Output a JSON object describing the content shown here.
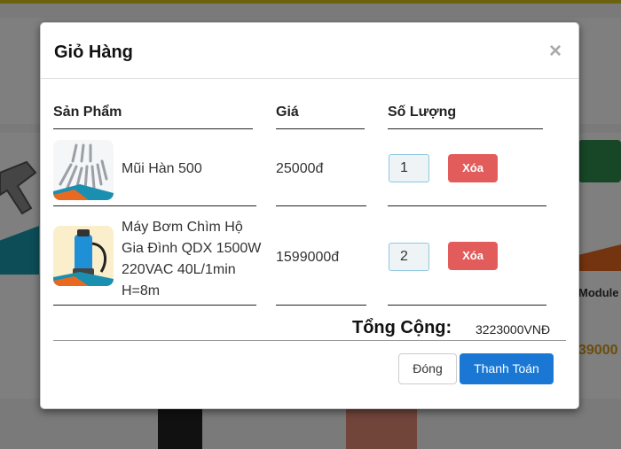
{
  "background": {
    "module_label": "Module",
    "price_fragment": "39000"
  },
  "cart": {
    "title": "Giỏ Hàng",
    "close_icon": "×",
    "columns": {
      "product": "Sản Phẩm",
      "price": "Giá",
      "quantity": "Số Lượng"
    },
    "items": [
      {
        "name": "Mũi Hàn 500",
        "price": "25000đ",
        "quantity": "1",
        "delete_label": "Xóa",
        "image": "soldering-tips-image"
      },
      {
        "name": "Máy Bơm Chìm Hộ Gia Đình QDX 1500W 220VAC 40L/1min H=8m",
        "price": "1599000đ",
        "quantity": "2",
        "delete_label": "Xóa",
        "image": "submersible-pump-image"
      }
    ],
    "total_label": "Tổng Cộng:",
    "total_value": "3223000VNĐ",
    "close_button": "Đóng",
    "checkout_button": "Thanh Toán"
  },
  "colors": {
    "delete_button": "#e35c5c",
    "checkout_button": "#1a78d4",
    "overlay": "rgba(0,0,0,0.5)"
  }
}
